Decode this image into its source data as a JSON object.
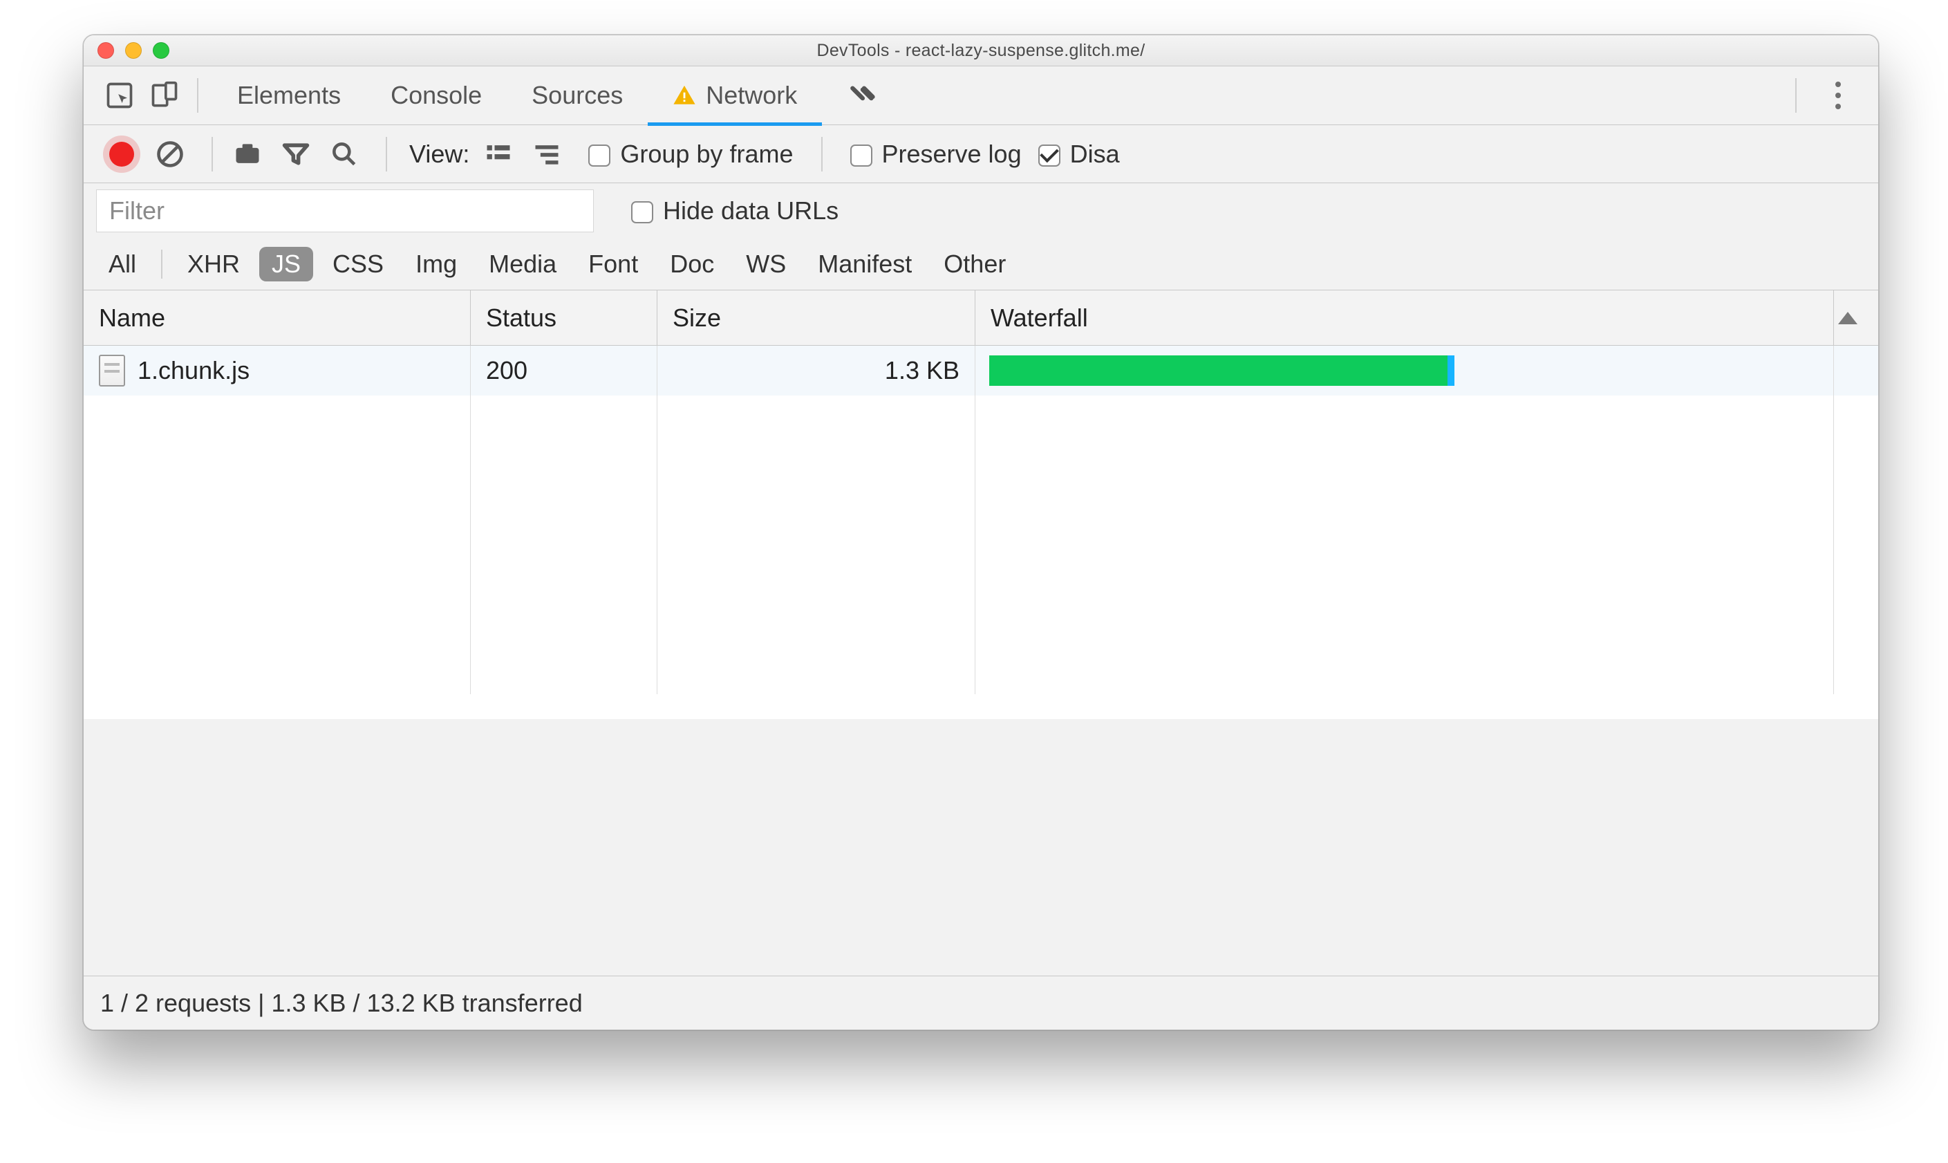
{
  "window": {
    "title": "DevTools - react-lazy-suspense.glitch.me/"
  },
  "tabs": [
    "Elements",
    "Console",
    "Sources",
    "Network"
  ],
  "active_tab": "Network",
  "toolbar": {
    "view_label": "View:",
    "group_by_frame": "Group by frame",
    "preserve_log": "Preserve log",
    "disable_cache_truncated": "Disa",
    "group_by_frame_checked": false,
    "preserve_log_checked": false,
    "disable_cache_checked": true
  },
  "filter": {
    "placeholder": "Filter",
    "hide_data_urls": "Hide data URLs",
    "hide_data_urls_checked": false
  },
  "types": [
    "All",
    "XHR",
    "JS",
    "CSS",
    "Img",
    "Media",
    "Font",
    "Doc",
    "WS",
    "Manifest",
    "Other"
  ],
  "selected_type": "JS",
  "columns": [
    "Name",
    "Status",
    "Size",
    "Waterfall"
  ],
  "rows": [
    {
      "name": "1.chunk.js",
      "status": "200",
      "size": "1.3 KB"
    }
  ],
  "status": "1 / 2 requests | 1.3 KB / 13.2 KB transferred",
  "colors": {
    "accent": "#1a9bf0",
    "record": "#e22",
    "waterfall_main": "#0ecb5b",
    "waterfall_tail": "#17b4ff",
    "filter_active": "#e13b3b"
  }
}
